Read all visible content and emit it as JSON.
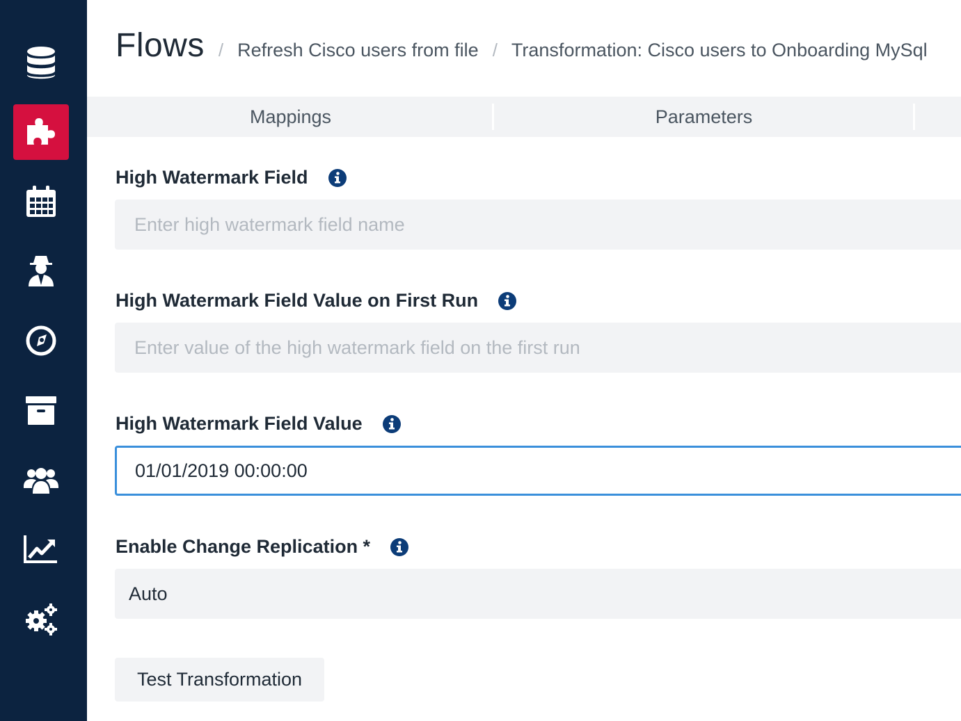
{
  "breadcrumb": {
    "title": "Flows",
    "separator": "/",
    "items": [
      "Refresh Cisco users from file",
      "Transformation: Cisco users to Onboarding MySql"
    ]
  },
  "tabs": [
    {
      "label": "Mappings"
    },
    {
      "label": "Parameters"
    }
  ],
  "sidebar": {
    "items": [
      {
        "icon": "database-icon"
      },
      {
        "icon": "puzzle-icon",
        "active": true
      },
      {
        "icon": "calendar-icon"
      },
      {
        "icon": "agent-icon"
      },
      {
        "icon": "compass-icon"
      },
      {
        "icon": "archive-icon"
      },
      {
        "icon": "users-icon"
      },
      {
        "icon": "chart-line-icon"
      },
      {
        "icon": "gears-icon"
      }
    ]
  },
  "form": {
    "hwm_field": {
      "label": "High Watermark Field",
      "placeholder": "Enter high watermark field name",
      "value": ""
    },
    "hwm_first_run": {
      "label": "High Watermark Field Value on First Run",
      "placeholder": "Enter value of the high watermark field on the first run",
      "value": ""
    },
    "hwm_value": {
      "label": "High Watermark Field Value",
      "value": "01/01/2019 00:00:00"
    },
    "change_replication": {
      "label": "Enable Change Replication *",
      "selected": "Auto"
    }
  },
  "actions": {
    "test_label": "Test Transformation"
  },
  "colors": {
    "sidebar_bg": "#0c2340",
    "active_accent": "#d5103f",
    "focus_border": "#3a8fdb",
    "info_icon": "#0c3c78"
  }
}
